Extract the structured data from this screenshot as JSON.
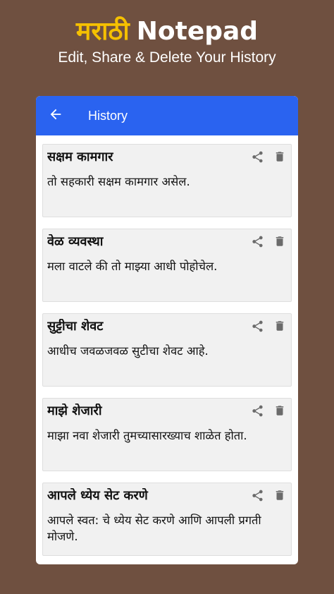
{
  "promo": {
    "title_marathi": "मराठी",
    "title_english": "Notepad",
    "subtitle": "Edit, Share & Delete Your History"
  },
  "app_bar": {
    "title": "History",
    "back_icon": "arrow-left-icon",
    "color": "#2a63f0"
  },
  "icons": {
    "share": "share-icon",
    "delete": "trash-icon"
  },
  "history": [
    {
      "title": "सक्षम कामगार",
      "body": "तो सहकारी सक्षम कामगार असेल."
    },
    {
      "title": "वेळ व्यवस्था",
      "body": "मला वाटले की तो माझ्या आधी पोहोचेल."
    },
    {
      "title": "सुट्टीचा शेवट",
      "body": "आधीच जवळजवळ सुटीचा शेवट आहे."
    },
    {
      "title": "माझे शेजारी",
      "body": "माझा नवा शेजारी तुमच्यासारख्याच शाळेत होता."
    },
    {
      "title": "आपले ध्येय सेट करणे",
      "body": "आपले स्वत: चे ध्येय सेट करणे आणि आपली प्रगती मोजणे."
    }
  ]
}
